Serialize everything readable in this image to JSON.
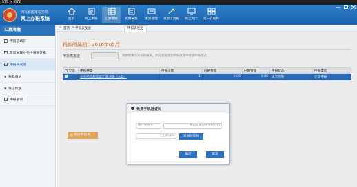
{
  "window": {
    "title": "579 × 672"
  },
  "brand": {
    "subtitle": "河北省国家税务局",
    "title": "网上办税系统"
  },
  "nav": [
    {
      "label": "首页",
      "icon": "home-icon"
    },
    {
      "label": "网上申报",
      "icon": "form-icon"
    },
    {
      "label": "汇算清缴",
      "icon": "grid-icon"
    },
    {
      "label": "优惠采集",
      "icon": "document-icon"
    },
    {
      "label": "发票管理",
      "icon": "invoice-icon"
    },
    {
      "label": "发票工具箱",
      "icon": "toolbox-icon"
    },
    {
      "label": "网上大厅",
      "icon": "monitor-icon"
    },
    {
      "label": "第三方软件",
      "icon": "apps-icon"
    }
  ],
  "sidebar": {
    "header": "汇算清缴",
    "items": [
      {
        "label": "申报表填写"
      },
      {
        "label": "年度关联业务往来报告表"
      },
      {
        "label": "申报表发送"
      },
      {
        "label": "税款缴纳"
      },
      {
        "label": "凭证传送"
      },
      {
        "label": "申报查询"
      }
    ]
  },
  "breadcrumb": {
    "home": "首页",
    "sep": ">",
    "current": "申报表发送",
    "tab": "申报表发送"
  },
  "main": {
    "period": "税款所属期：2016年05月",
    "collection_type_label": "申报表发送",
    "tip": "请依据填写完毕的报表，如已发送请到申报查询中查询申报状态"
  },
  "table": {
    "headers": [
      "全选",
      "申报种类",
      "申报次数",
      "应纳税额",
      "已纳金额",
      "申报状态",
      "申报类型"
    ],
    "rows": [
      {
        "name": "企业所得税年度汇算清缴（A类）",
        "times": "1",
        "tax": "0.00",
        "paid": "0.00",
        "status": "填写完整",
        "type": "正常申报"
      }
    ]
  },
  "send_button": "发送申报表",
  "dialog": {
    "title": "免费手机验证码",
    "role_select": "用户身份",
    "phone_placeholder": "税款机关留存手机号码",
    "code_placeholder": "手机验证码",
    "send_code": "发送验证码",
    "confirm": "确定",
    "cancel": "取消"
  },
  "colors": {
    "header_blue": "#1b63ad",
    "selected_row": "#2e72c4",
    "period_orange": "#e0732a",
    "send_button": "#f3b461"
  }
}
